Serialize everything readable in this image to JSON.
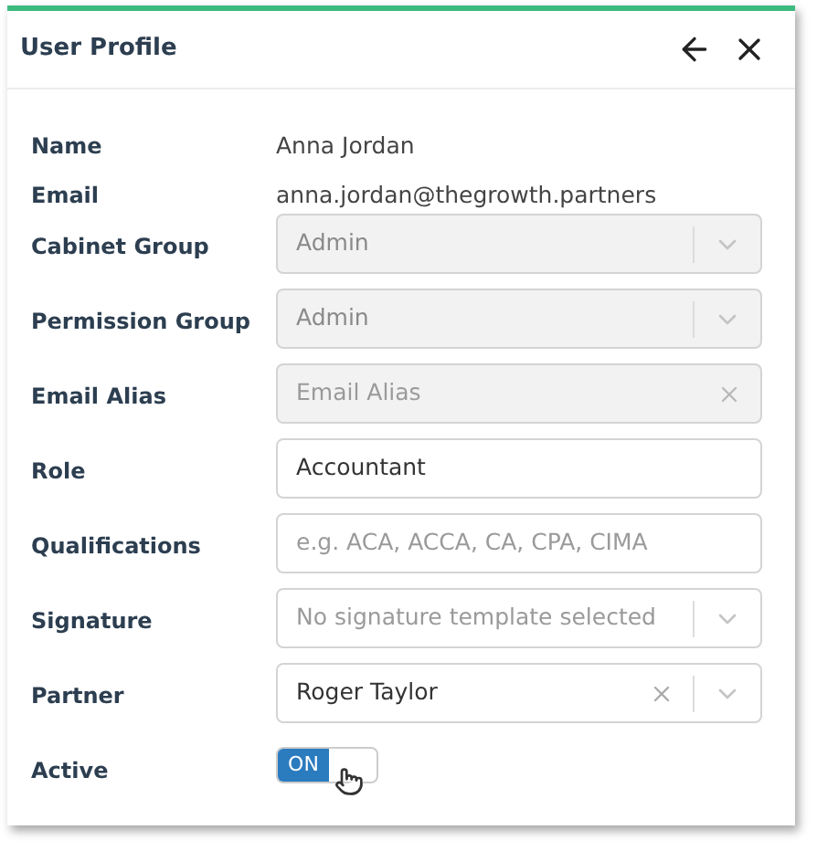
{
  "window": {
    "title": "User Profile"
  },
  "fields": [
    {
      "kind": "text",
      "label": "Name",
      "value": "Anna Jordan"
    },
    {
      "kind": "text",
      "label": "Email",
      "value": "anna.jordan@thegrowth.partners"
    },
    {
      "kind": "select",
      "label": "Cabinet Group",
      "value": "Admin",
      "disabled": true,
      "clearable": false
    },
    {
      "kind": "select",
      "label": "Permission Group",
      "value": "Admin",
      "disabled": true,
      "clearable": false
    },
    {
      "kind": "input",
      "label": "Email Alias",
      "placeholder": "Email Alias",
      "disabled": true,
      "clearable": true
    },
    {
      "kind": "input",
      "label": "Role",
      "value": "Accountant",
      "disabled": false,
      "clearable": false
    },
    {
      "kind": "input",
      "label": "Qualifications",
      "placeholder": "e.g. ACA, ACCA, CA, CPA, CIMA",
      "disabled": false,
      "clearable": false
    },
    {
      "kind": "select",
      "label": "Signature",
      "placeholder": "No signature template selected",
      "disabled": false,
      "clearable": false
    },
    {
      "kind": "select",
      "label": "Partner",
      "value": "Roger Taylor",
      "disabled": false,
      "clearable": true
    },
    {
      "kind": "toggle",
      "label": "Active",
      "on": true,
      "text": "ON"
    }
  ]
}
